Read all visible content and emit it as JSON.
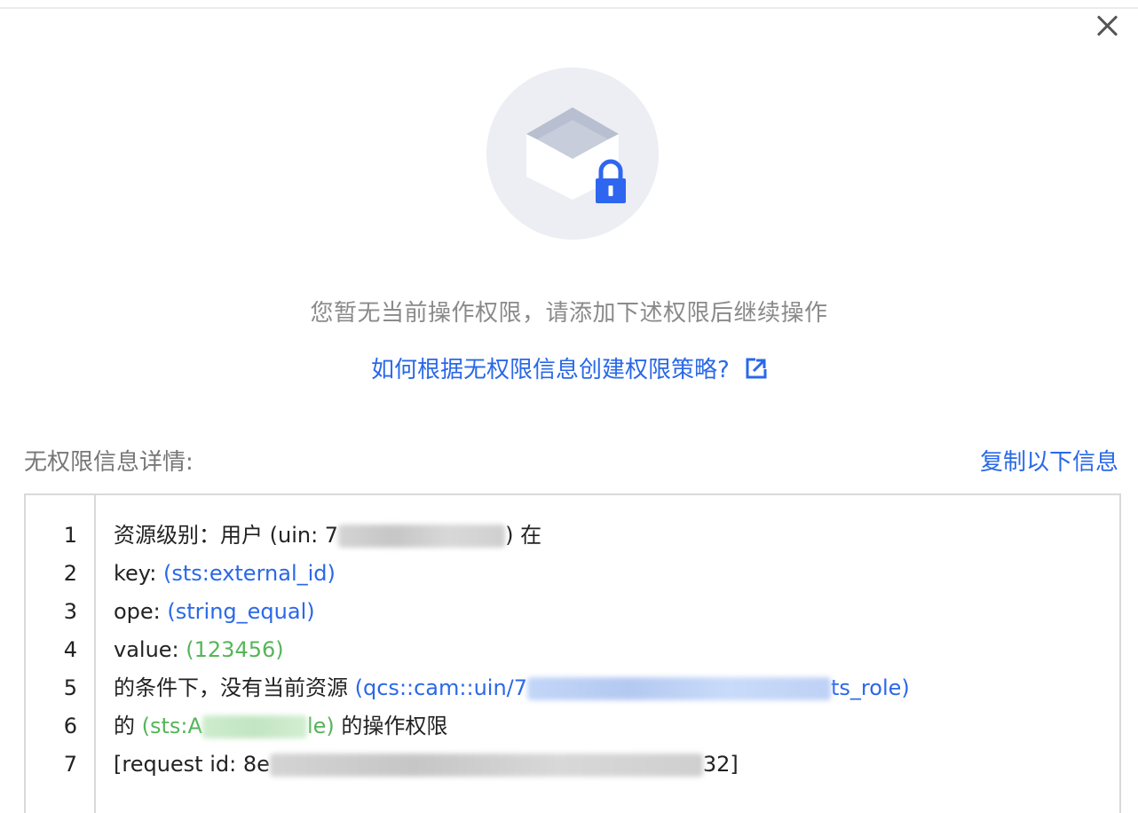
{
  "dialog": {
    "message": "您暂无当前操作权限，请添加下述权限后继续操作",
    "help_link": "如何根据无权限信息创建权限策略?",
    "detail_title": "无权限信息详情:",
    "copy_label": "复制以下信息"
  },
  "colors": {
    "link_blue": "#2a68e8",
    "value_green": "#55b559",
    "muted_text": "#8a8a8a",
    "lock_blue": "#2f66f0"
  },
  "icons": {
    "close": "close-icon",
    "illustration": "box-lock-icon",
    "external_link": "external-link-icon"
  },
  "code_lines": [
    {
      "num": "1",
      "prefix": "资源级别：用户 (uin: 7",
      "suffix": ") 在"
    },
    {
      "num": "2",
      "key_label": "key: ",
      "key_value": "(sts:external_id)"
    },
    {
      "num": "3",
      "ope_label": "ope: ",
      "ope_value": "(string_equal)"
    },
    {
      "num": "4",
      "value_label": "value: ",
      "value_value": "(123456)"
    },
    {
      "num": "5",
      "prefix": "的条件下，没有当前资源 ",
      "res_start": "(qcs::cam::uin/7",
      "res_end": "ts_role)"
    },
    {
      "num": "6",
      "prefix": "的 ",
      "action_start": "(sts:A",
      "action_end": "le)",
      "suffix": " 的操作权限"
    },
    {
      "num": "7",
      "prefix": "[request id: 8e",
      "suffix": "32]"
    }
  ]
}
